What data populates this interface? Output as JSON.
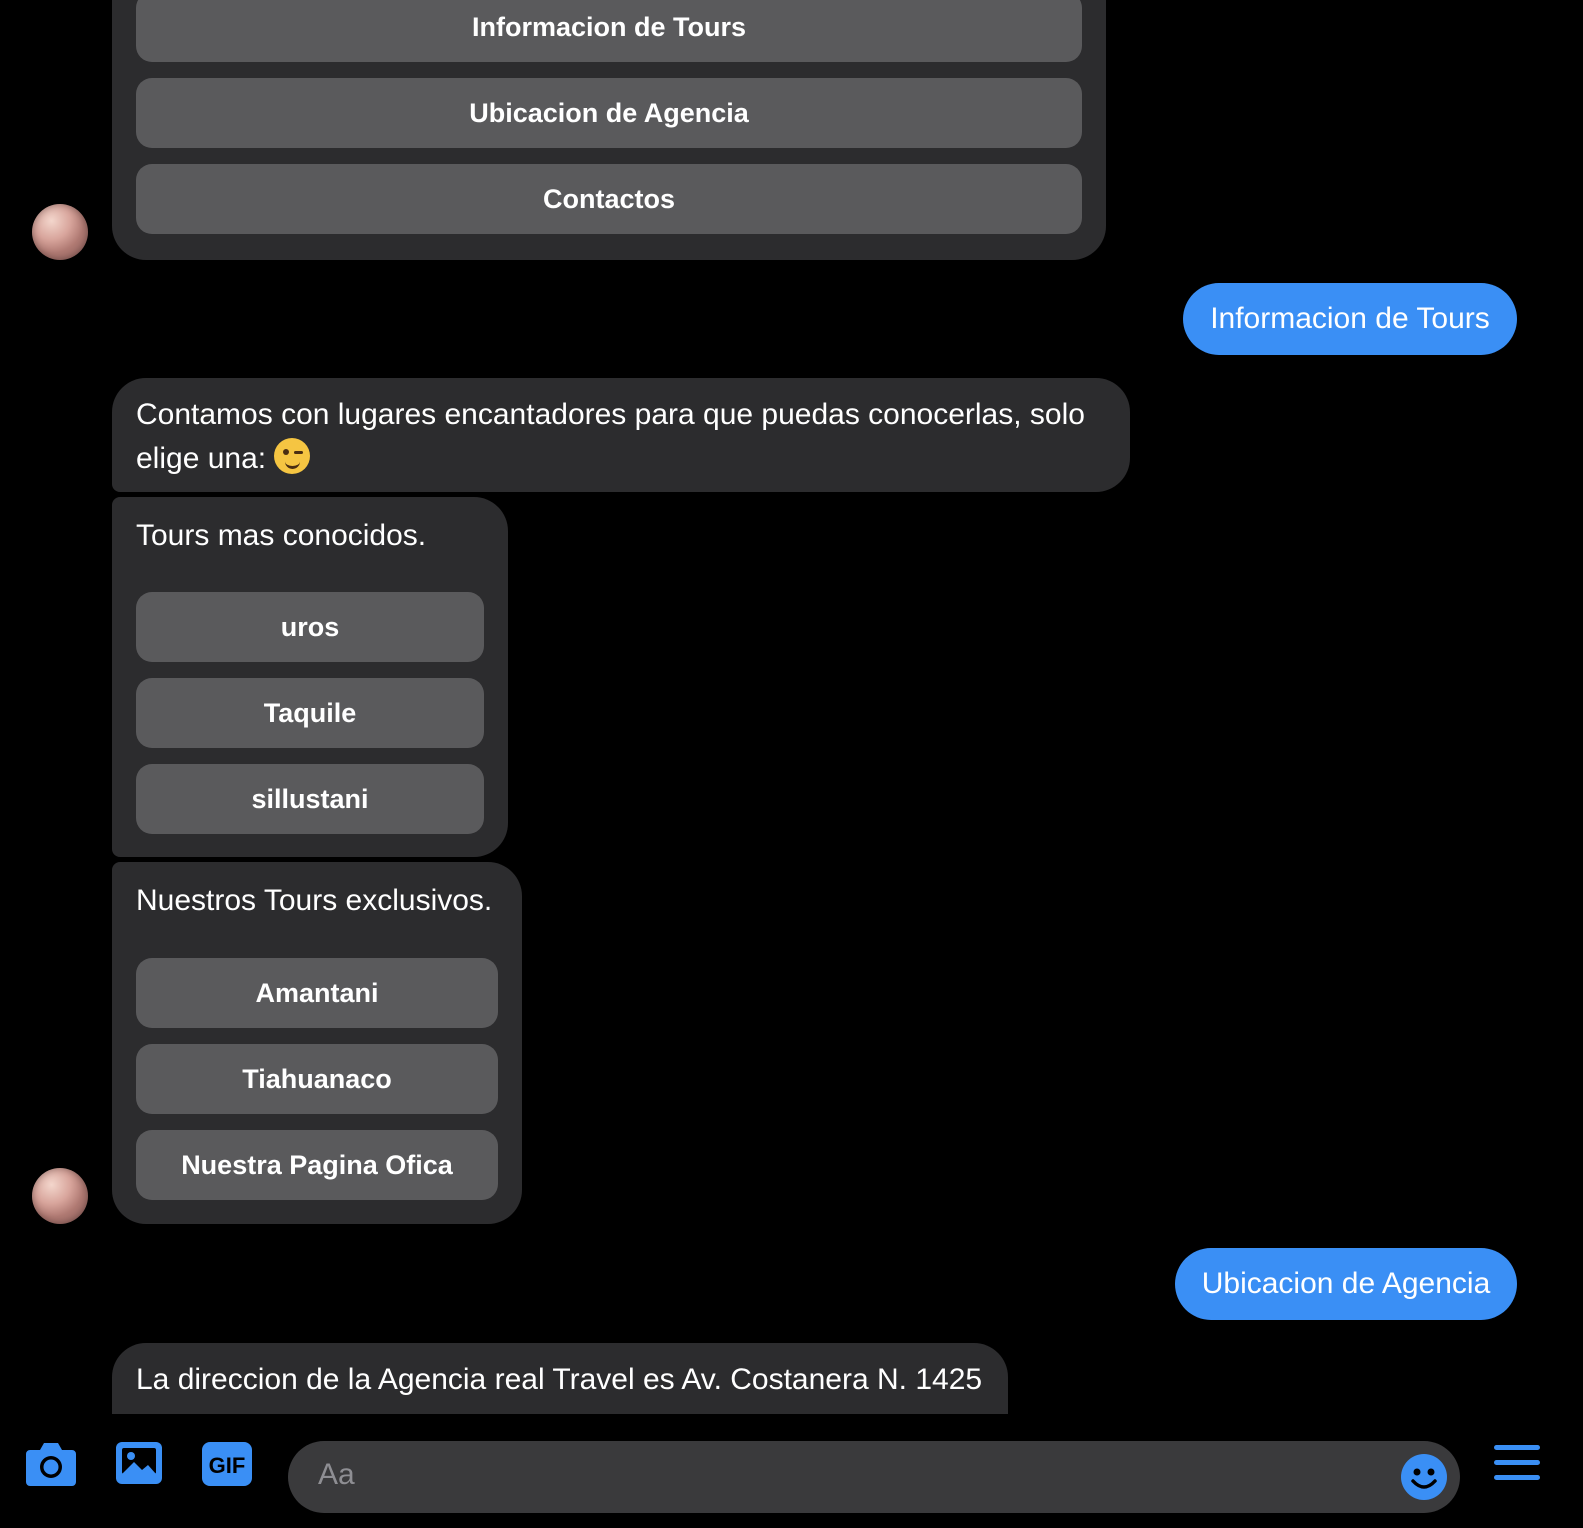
{
  "colors": {
    "accent": "#3a8ff5",
    "incoming_bubble": "#2c2c2e",
    "quick_reply": "#5a5a5c"
  },
  "menu_card": {
    "buttons": [
      "Informacion de Tours",
      "Ubicacion de Agencia",
      "Contactos"
    ]
  },
  "messages": {
    "out_1": "Informacion de Tours",
    "in_1": "Contamos con lugares encantadores para que puedas conocerlas, solo elige una:",
    "in_1_emoji": "winking-face",
    "out_2": "Ubicacion de Agencia",
    "in_2": "La direccion de la Agencia real Travel es Av. Costanera N. 1425"
  },
  "card_known": {
    "title": "Tours mas conocidos.",
    "buttons": [
      "uros",
      "Taquile",
      "sillustani"
    ]
  },
  "card_exclusive": {
    "title": "Nuestros Tours exclusivos.",
    "buttons": [
      "Amantani",
      "Tiahuanaco",
      "Nuestra Pagina Ofica"
    ]
  },
  "composer": {
    "placeholder": "Aa",
    "icons": [
      "camera-icon",
      "image-icon",
      "gif-icon",
      "emoji-icon",
      "menu-icon"
    ]
  }
}
